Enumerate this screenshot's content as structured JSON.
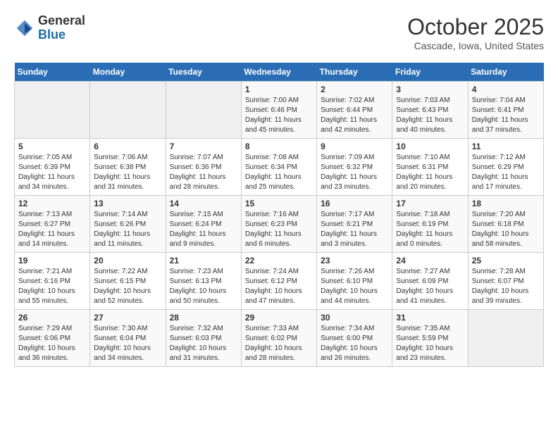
{
  "header": {
    "logo_general": "General",
    "logo_blue": "Blue",
    "title": "October 2025",
    "subtitle": "Cascade, Iowa, United States"
  },
  "days_of_week": [
    "Sunday",
    "Monday",
    "Tuesday",
    "Wednesday",
    "Thursday",
    "Friday",
    "Saturday"
  ],
  "weeks": [
    [
      {
        "day": "",
        "info": ""
      },
      {
        "day": "",
        "info": ""
      },
      {
        "day": "",
        "info": ""
      },
      {
        "day": "1",
        "info": "Sunrise: 7:00 AM\nSunset: 6:46 PM\nDaylight: 11 hours\nand 45 minutes."
      },
      {
        "day": "2",
        "info": "Sunrise: 7:02 AM\nSunset: 6:44 PM\nDaylight: 11 hours\nand 42 minutes."
      },
      {
        "day": "3",
        "info": "Sunrise: 7:03 AM\nSunset: 6:43 PM\nDaylight: 11 hours\nand 40 minutes."
      },
      {
        "day": "4",
        "info": "Sunrise: 7:04 AM\nSunset: 6:41 PM\nDaylight: 11 hours\nand 37 minutes."
      }
    ],
    [
      {
        "day": "5",
        "info": "Sunrise: 7:05 AM\nSunset: 6:39 PM\nDaylight: 11 hours\nand 34 minutes."
      },
      {
        "day": "6",
        "info": "Sunrise: 7:06 AM\nSunset: 6:38 PM\nDaylight: 11 hours\nand 31 minutes."
      },
      {
        "day": "7",
        "info": "Sunrise: 7:07 AM\nSunset: 6:36 PM\nDaylight: 11 hours\nand 28 minutes."
      },
      {
        "day": "8",
        "info": "Sunrise: 7:08 AM\nSunset: 6:34 PM\nDaylight: 11 hours\nand 25 minutes."
      },
      {
        "day": "9",
        "info": "Sunrise: 7:09 AM\nSunset: 6:32 PM\nDaylight: 11 hours\nand 23 minutes."
      },
      {
        "day": "10",
        "info": "Sunrise: 7:10 AM\nSunset: 6:31 PM\nDaylight: 11 hours\nand 20 minutes."
      },
      {
        "day": "11",
        "info": "Sunrise: 7:12 AM\nSunset: 6:29 PM\nDaylight: 11 hours\nand 17 minutes."
      }
    ],
    [
      {
        "day": "12",
        "info": "Sunrise: 7:13 AM\nSunset: 6:27 PM\nDaylight: 11 hours\nand 14 minutes."
      },
      {
        "day": "13",
        "info": "Sunrise: 7:14 AM\nSunset: 6:26 PM\nDaylight: 11 hours\nand 11 minutes."
      },
      {
        "day": "14",
        "info": "Sunrise: 7:15 AM\nSunset: 6:24 PM\nDaylight: 11 hours\nand 9 minutes."
      },
      {
        "day": "15",
        "info": "Sunrise: 7:16 AM\nSunset: 6:23 PM\nDaylight: 11 hours\nand 6 minutes."
      },
      {
        "day": "16",
        "info": "Sunrise: 7:17 AM\nSunset: 6:21 PM\nDaylight: 11 hours\nand 3 minutes."
      },
      {
        "day": "17",
        "info": "Sunrise: 7:18 AM\nSunset: 6:19 PM\nDaylight: 11 hours\nand 0 minutes."
      },
      {
        "day": "18",
        "info": "Sunrise: 7:20 AM\nSunset: 6:18 PM\nDaylight: 10 hours\nand 58 minutes."
      }
    ],
    [
      {
        "day": "19",
        "info": "Sunrise: 7:21 AM\nSunset: 6:16 PM\nDaylight: 10 hours\nand 55 minutes."
      },
      {
        "day": "20",
        "info": "Sunrise: 7:22 AM\nSunset: 6:15 PM\nDaylight: 10 hours\nand 52 minutes."
      },
      {
        "day": "21",
        "info": "Sunrise: 7:23 AM\nSunset: 6:13 PM\nDaylight: 10 hours\nand 50 minutes."
      },
      {
        "day": "22",
        "info": "Sunrise: 7:24 AM\nSunset: 6:12 PM\nDaylight: 10 hours\nand 47 minutes."
      },
      {
        "day": "23",
        "info": "Sunrise: 7:26 AM\nSunset: 6:10 PM\nDaylight: 10 hours\nand 44 minutes."
      },
      {
        "day": "24",
        "info": "Sunrise: 7:27 AM\nSunset: 6:09 PM\nDaylight: 10 hours\nand 41 minutes."
      },
      {
        "day": "25",
        "info": "Sunrise: 7:28 AM\nSunset: 6:07 PM\nDaylight: 10 hours\nand 39 minutes."
      }
    ],
    [
      {
        "day": "26",
        "info": "Sunrise: 7:29 AM\nSunset: 6:06 PM\nDaylight: 10 hours\nand 36 minutes."
      },
      {
        "day": "27",
        "info": "Sunrise: 7:30 AM\nSunset: 6:04 PM\nDaylight: 10 hours\nand 34 minutes."
      },
      {
        "day": "28",
        "info": "Sunrise: 7:32 AM\nSunset: 6:03 PM\nDaylight: 10 hours\nand 31 minutes."
      },
      {
        "day": "29",
        "info": "Sunrise: 7:33 AM\nSunset: 6:02 PM\nDaylight: 10 hours\nand 28 minutes."
      },
      {
        "day": "30",
        "info": "Sunrise: 7:34 AM\nSunset: 6:00 PM\nDaylight: 10 hours\nand 26 minutes."
      },
      {
        "day": "31",
        "info": "Sunrise: 7:35 AM\nSunset: 5:59 PM\nDaylight: 10 hours\nand 23 minutes."
      },
      {
        "day": "",
        "info": ""
      }
    ]
  ]
}
